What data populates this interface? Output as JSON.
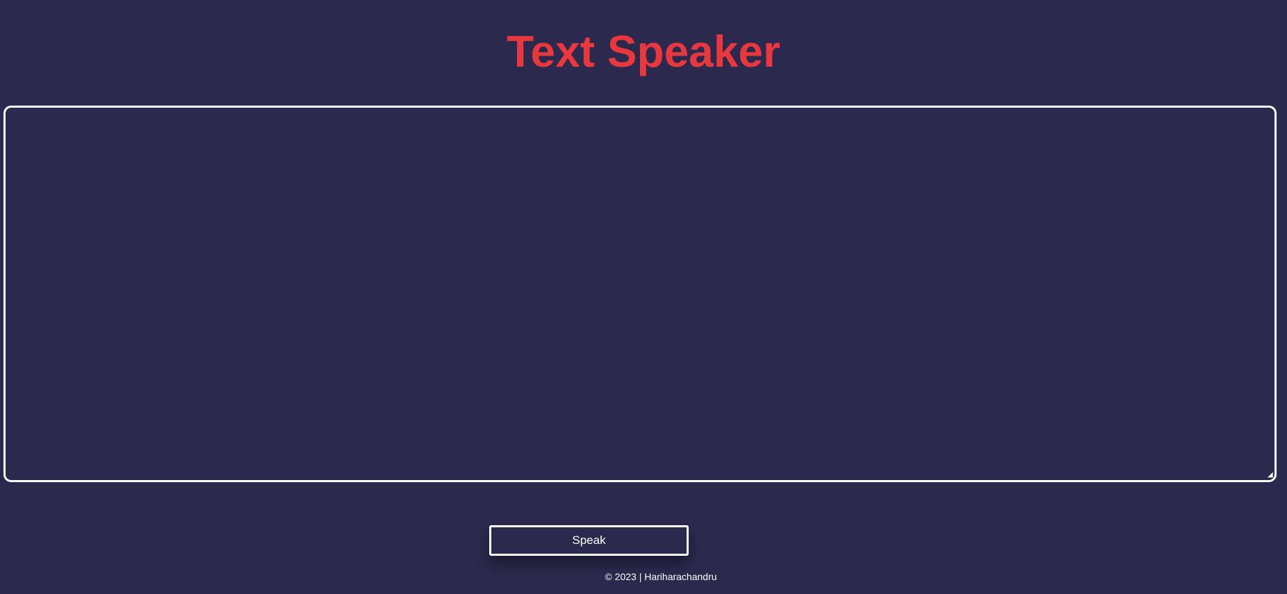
{
  "app": {
    "title": "Text Speaker"
  },
  "editor": {
    "value": "",
    "placeholder": ""
  },
  "actions": {
    "speak_label": "Speak"
  },
  "footer": {
    "text": "© 2023 | Hariharachandru"
  },
  "colors": {
    "background": "#2b294d",
    "title": "#e8383d",
    "border": "#ffffff",
    "text": "#ffffff"
  }
}
